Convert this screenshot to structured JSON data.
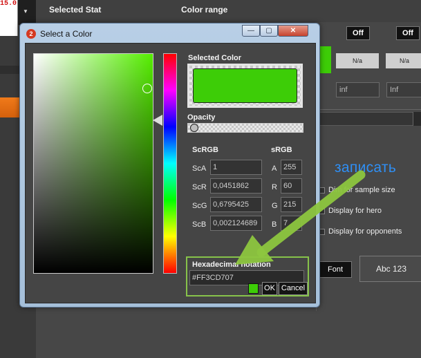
{
  "background": {
    "left_red_text": "15.0",
    "header": {
      "selected_stat": "Selected Stat",
      "color_range": "Color range"
    },
    "off_buttons": [
      "Off",
      "Off"
    ],
    "na_cells": [
      "N/a",
      "N/a"
    ],
    "inf_fields": [
      "inf",
      "Inf"
    ],
    "checkboxes": [
      "Dim for sample size",
      "Display for hero",
      "Display for opponents"
    ],
    "font_button": "Font",
    "preview_text": "Abc 123"
  },
  "overlay_annotation": "записать",
  "dialog": {
    "title": "Select a Color",
    "icon_glyph": "2",
    "window_buttons": {
      "minimize": "—",
      "maximize": "▢",
      "close": "✕"
    },
    "selected_color_label": "Selected Color",
    "selected_color_hex": "#3dcd07",
    "hue_base_color": "#55ee00",
    "opacity_label": "Opacity",
    "scrgb_label": "ScRGB",
    "srgb_label": "sRGB",
    "scrgb": [
      {
        "label": "ScA",
        "value": "1"
      },
      {
        "label": "ScR",
        "value": "0,0451862"
      },
      {
        "label": "ScG",
        "value": "0,6795425"
      },
      {
        "label": "ScB",
        "value": "0,002124689"
      }
    ],
    "srgb": [
      {
        "label": "A",
        "value": "255"
      },
      {
        "label": "R",
        "value": "60"
      },
      {
        "label": "G",
        "value": "215"
      },
      {
        "label": "B",
        "value": "7"
      }
    ],
    "hex_label": "Hexadecimal notation",
    "hex_value": "#FF3CD707",
    "ok_label": "OK",
    "cancel_label": "Cancel"
  },
  "colors": {
    "accent_arrow": "#8dc63f",
    "overlay_text": "#2f8ff5",
    "orange_tab": "#f07a1a"
  }
}
